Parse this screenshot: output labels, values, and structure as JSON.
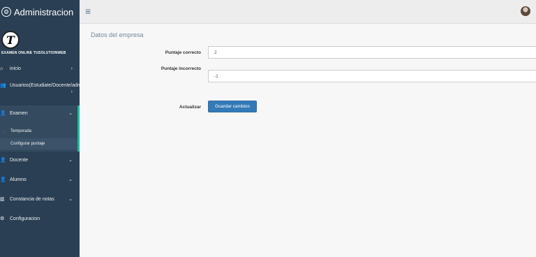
{
  "sidebar": {
    "title": "Administracion",
    "logo_text": "EXAMEN ONLINE TUSOLUTIONWEB",
    "items": [
      {
        "label": "inicio",
        "icon": "home-icon"
      },
      {
        "label": "Usuarios(Estudiate/Docente/admin)",
        "icon": "users-icon"
      },
      {
        "label": "Examen",
        "icon": "user-icon"
      },
      {
        "label": "Docente",
        "icon": "user-icon"
      },
      {
        "label": "Alumno",
        "icon": "user-icon"
      },
      {
        "label": "Constancia de notas",
        "icon": "bar-chart-icon"
      },
      {
        "label": "Configuracion",
        "icon": "gear-icon"
      }
    ],
    "subitems": [
      {
        "label": "Temporada"
      },
      {
        "label": "Configurar puntaje"
      }
    ]
  },
  "header": {
    "menu_icon": "hamburger-icon"
  },
  "main": {
    "panel_title": "Datos del empresa",
    "fields": {
      "correct": {
        "label": "Puntaje correcto",
        "value": "2"
      },
      "incorrect": {
        "label": "Puntaje incorrecto",
        "value": "-1"
      }
    },
    "actualizar_label": "Actualizar",
    "save_label": "Guardar cambios"
  },
  "colors": {
    "sidebar": "#2a3f54",
    "accent": "#1abb9c",
    "button": "#337ab7"
  }
}
